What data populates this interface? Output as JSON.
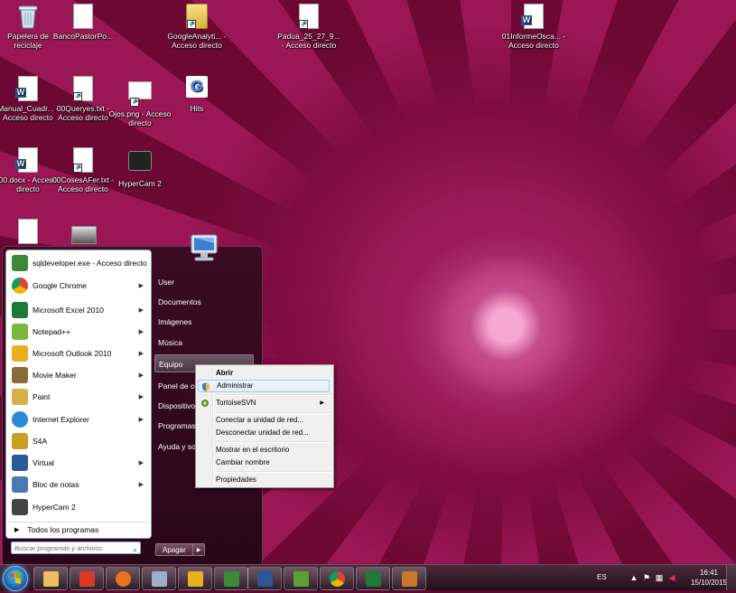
{
  "desktop": {
    "icons": [
      {
        "label": "Papelera de reciclaje",
        "icon": "recycle-bin-icon"
      },
      {
        "label": "BancoPastorPo...",
        "icon": "document-icon"
      },
      {
        "label": "GoogleAnalyti... - Acceso directo",
        "icon": "folder-shortcut-icon"
      },
      {
        "label": "Padua_25_27_9... - Acceso directo",
        "icon": "document-shortcut-icon"
      },
      {
        "label": "01InformeOsca... - Acceso directo",
        "icon": "word-document-icon"
      },
      {
        "label": "Manual_Cuadr... - Acceso directo",
        "icon": "word-document-icon"
      },
      {
        "label": "00Queryes.txt - Acceso directo",
        "icon": "text-file-icon"
      },
      {
        "label": "Ojos.png - Acceso directo",
        "icon": "image-file-icon"
      },
      {
        "label": "Hits",
        "icon": "google-icon"
      },
      {
        "label": "00.docx - Acceso directo",
        "icon": "word-document-icon"
      },
      {
        "label": "00CosesAFer.txt - Acceso directo",
        "icon": "text-file-icon"
      },
      {
        "label": "HyperCam 2",
        "icon": "hypercam-icon"
      }
    ]
  },
  "start_menu": {
    "programs": [
      {
        "label": "sqldeveloper.exe - Acceso directo",
        "icon": "sqldeveloper-icon",
        "color": "#3a8a3a",
        "submenu": false
      },
      {
        "label": "Google Chrome",
        "icon": "chrome-icon",
        "color": "#e8a41c",
        "submenu": true
      },
      {
        "label": "Microsoft Excel 2010",
        "icon": "excel-icon",
        "color": "#1f7a3a",
        "submenu": true
      },
      {
        "label": "Notepad++",
        "icon": "notepadpp-icon",
        "color": "#7bb53a",
        "submenu": true
      },
      {
        "label": "Microsoft Outlook 2010",
        "icon": "outlook-icon",
        "color": "#e8b01c",
        "submenu": true
      },
      {
        "label": "Movie Maker",
        "icon": "movie-maker-icon",
        "color": "#8a6a3a",
        "submenu": true
      },
      {
        "label": "Paint",
        "icon": "paint-icon",
        "color": "#d8b04a",
        "submenu": true
      },
      {
        "label": "Internet Explorer",
        "icon": "internet-explorer-icon",
        "color": "#2a8ad8",
        "submenu": true
      },
      {
        "label": "S4A",
        "icon": "s4a-icon",
        "color": "#c8a020",
        "submenu": false
      },
      {
        "label": "Virtual",
        "icon": "virtualbox-icon",
        "color": "#2a5a9a",
        "submenu": true
      },
      {
        "label": "Bloc de notas",
        "icon": "notepad-icon",
        "color": "#4a7ab0",
        "submenu": true
      },
      {
        "label": "HyperCam 2",
        "icon": "hypercam-icon",
        "color": "#444444",
        "submenu": false
      }
    ],
    "all_programs": "Todos los programas",
    "search_placeholder": "Buscar programas y archivos",
    "right_items": [
      "User",
      "Documentos",
      "Imágenes",
      "Música",
      "Equipo",
      "Panel de cor",
      "Dispositivos",
      "Programas p",
      "Ayuda y sop"
    ],
    "shutdown_label": "Apagar"
  },
  "context_menu": {
    "items": [
      "Abrir",
      "Administrar",
      "TortoiseSVN",
      "Conectar a unidad de red...",
      "Desconectar unidad de red...",
      "Mostrar en el escritorio",
      "Cambiar nombre",
      "Propiedades"
    ]
  },
  "taskbar": {
    "apps": [
      {
        "icon": "explorer-icon",
        "color": "#e8c15a"
      },
      {
        "icon": "acrobat-icon",
        "color": "#d83a2a"
      },
      {
        "icon": "firefox-icon",
        "color": "#e8731c"
      },
      {
        "icon": "calculator-icon",
        "color": "#9ab0c8"
      },
      {
        "icon": "outlook-icon",
        "color": "#e8b01c"
      },
      {
        "icon": "sqldeveloper-icon",
        "color": "#3a8a3a"
      },
      {
        "icon": "word-icon",
        "color": "#2b5797"
      },
      {
        "icon": "chart-app-icon",
        "color": "#5aa03a"
      },
      {
        "icon": "chrome-icon",
        "color": "#e8a41c"
      },
      {
        "icon": "excel-icon",
        "color": "#1f7a3a"
      },
      {
        "icon": "tool-icon",
        "color": "#c87a2a"
      }
    ],
    "language": "ES",
    "time": "16:41",
    "date": "15/10/2015"
  }
}
